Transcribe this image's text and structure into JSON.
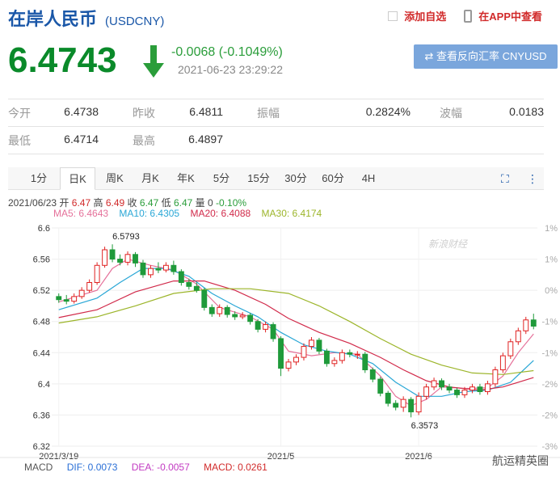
{
  "header": {
    "name": "在岸人民币",
    "code": "(USDCNY)",
    "add_watch": "添加自选",
    "app_view": "在APP中查看"
  },
  "quote": {
    "price": "6.4743",
    "change": "-0.0068 (-0.1049%)",
    "timestamp": "2021-06-23 23:29:22",
    "reverse_button": "⇄ 查看反向汇率 CNYUSD",
    "down_color": "#0a8a2a"
  },
  "stats": [
    [
      {
        "label": "今开",
        "value": "6.4738"
      },
      {
        "label": "昨收",
        "value": "6.4811"
      },
      {
        "label": "振幅",
        "value": "0.2824%"
      },
      {
        "label": "波幅",
        "value": "0.0183"
      }
    ],
    [
      {
        "label": "最低",
        "value": "6.4714"
      },
      {
        "label": "最高",
        "value": "6.4897"
      }
    ]
  ],
  "tabs": [
    "1分",
    "日K",
    "周K",
    "月K",
    "年K",
    "5分",
    "15分",
    "30分",
    "60分",
    "4H"
  ],
  "active_tab": "日K",
  "ohlc": {
    "date": "2021/06/23",
    "open_label": "开",
    "open": "6.47",
    "high_label": "高",
    "high": "6.49",
    "close_label": "收",
    "close": "6.47",
    "low_label": "低",
    "low": "6.47",
    "vol_label": "量",
    "vol": "0",
    "pct": "-0.10%"
  },
  "ma_legend": [
    {
      "text": "MA5: 6.4643",
      "color": "#e5719a"
    },
    {
      "text": "MA10: 6.4305",
      "color": "#2aa7d6"
    },
    {
      "text": "MA20: 6.4088",
      "color": "#d12a4a"
    },
    {
      "text": "MA30: 6.4174",
      "color": "#9cb52a"
    }
  ],
  "macd": {
    "label": "MACD",
    "dif": "DIF: 0.0073",
    "dea": "DEA: -0.0057",
    "macd": "MACD: 0.0261",
    "axis_value": "1"
  },
  "watermark": "新浪财经",
  "wechat_caption": "航运精英圈",
  "chart_data": {
    "type": "candlestick",
    "y_ticks": [
      "6.6",
      "6.56",
      "6.52",
      "6.48",
      "6.44",
      "6.4",
      "6.36",
      "6.32"
    ],
    "ylim": [
      6.32,
      6.6
    ],
    "pct_ticks": [
      "1%",
      "1%",
      "0%",
      "-1%",
      "-1%",
      "-2%",
      "-2%",
      "-3%"
    ],
    "x_labels": [
      {
        "label": "2021/3/19",
        "index": 0
      },
      {
        "label": "2021/5",
        "index": 29
      },
      {
        "label": "2021/6",
        "index": 47
      }
    ],
    "annotations": [
      {
        "text": "6.5793",
        "index": 7,
        "value": 6.5793
      },
      {
        "text": "6.3573",
        "index": 46,
        "value": 6.3573
      }
    ],
    "candles": [
      [
        6.512,
        6.508,
        6.516,
        6.504
      ],
      [
        6.508,
        6.506,
        6.514,
        6.502
      ],
      [
        6.506,
        6.512,
        6.516,
        6.503
      ],
      [
        6.512,
        6.52,
        6.524,
        6.509
      ],
      [
        6.52,
        6.53,
        6.534,
        6.517
      ],
      [
        6.53,
        6.552,
        6.556,
        6.527
      ],
      [
        6.552,
        6.572,
        6.576,
        6.549
      ],
      [
        6.572,
        6.56,
        6.579,
        6.556
      ],
      [
        6.56,
        6.556,
        6.566,
        6.552
      ],
      [
        6.556,
        6.566,
        6.57,
        6.552
      ],
      [
        6.566,
        6.555,
        6.569,
        6.55
      ],
      [
        6.555,
        6.54,
        6.559,
        6.536
      ],
      [
        6.54,
        6.548,
        6.552,
        6.536
      ],
      [
        6.548,
        6.546,
        6.556,
        6.542
      ],
      [
        6.546,
        6.552,
        6.556,
        6.543
      ],
      [
        6.552,
        6.544,
        6.558,
        6.54
      ],
      [
        6.544,
        6.53,
        6.547,
        6.526
      ],
      [
        6.53,
        6.525,
        6.535,
        6.521
      ],
      [
        6.525,
        6.52,
        6.53,
        6.517
      ],
      [
        6.52,
        6.498,
        6.523,
        6.494
      ],
      [
        6.498,
        6.49,
        6.502,
        6.486
      ],
      [
        6.49,
        6.498,
        6.502,
        6.486
      ],
      [
        6.498,
        6.489,
        6.501,
        6.485
      ],
      [
        6.489,
        6.486,
        6.493,
        6.482
      ],
      [
        6.486,
        6.488,
        6.492,
        6.483
      ],
      [
        6.488,
        6.48,
        6.491,
        6.476
      ],
      [
        6.48,
        6.47,
        6.483,
        6.466
      ],
      [
        6.47,
        6.476,
        6.48,
        6.466
      ],
      [
        6.476,
        6.458,
        6.479,
        6.454
      ],
      [
        6.458,
        6.42,
        6.461,
        6.41
      ],
      [
        6.42,
        6.428,
        6.432,
        6.416
      ],
      [
        6.428,
        6.434,
        6.438,
        6.424
      ],
      [
        6.434,
        6.448,
        6.452,
        6.43
      ],
      [
        6.448,
        6.456,
        6.46,
        6.444
      ],
      [
        6.456,
        6.442,
        6.459,
        6.438
      ],
      [
        6.442,
        6.426,
        6.445,
        6.422
      ],
      [
        6.426,
        6.43,
        6.434,
        6.422
      ],
      [
        6.43,
        6.44,
        6.444,
        6.426
      ],
      [
        6.44,
        6.438,
        6.444,
        6.434
      ],
      [
        6.438,
        6.438,
        6.442,
        6.432
      ],
      [
        6.438,
        6.418,
        6.441,
        6.414
      ],
      [
        6.418,
        6.406,
        6.421,
        6.402
      ],
      [
        6.406,
        6.388,
        6.409,
        6.384
      ],
      [
        6.388,
        6.375,
        6.391,
        6.371
      ],
      [
        6.375,
        6.37,
        6.379,
        6.366
      ],
      [
        6.37,
        6.38,
        6.384,
        6.364
      ],
      [
        6.38,
        6.364,
        6.383,
        6.357
      ],
      [
        6.364,
        6.384,
        6.389,
        6.36
      ],
      [
        6.384,
        6.396,
        6.4,
        6.38
      ],
      [
        6.396,
        6.404,
        6.408,
        6.392
      ],
      [
        6.404,
        6.396,
        6.407,
        6.392
      ],
      [
        6.396,
        6.392,
        6.4,
        6.388
      ],
      [
        6.392,
        6.386,
        6.395,
        6.382
      ],
      [
        6.386,
        6.392,
        6.396,
        6.382
      ],
      [
        6.392,
        6.396,
        6.4,
        6.388
      ],
      [
        6.396,
        6.39,
        6.4,
        6.386
      ],
      [
        6.39,
        6.4,
        6.404,
        6.386
      ],
      [
        6.4,
        6.418,
        6.422,
        6.396
      ],
      [
        6.418,
        6.436,
        6.44,
        6.414
      ],
      [
        6.436,
        6.454,
        6.458,
        6.432
      ],
      [
        6.454,
        6.468,
        6.472,
        6.45
      ],
      [
        6.468,
        6.482,
        6.486,
        6.464
      ],
      [
        6.482,
        6.474,
        6.49,
        6.47
      ]
    ],
    "ma_lines": {
      "MA5": [
        [
          0,
          6.505
        ],
        [
          5,
          6.52
        ],
        [
          7,
          6.548
        ],
        [
          9,
          6.56
        ],
        [
          12,
          6.552
        ],
        [
          15,
          6.546
        ],
        [
          18,
          6.528
        ],
        [
          21,
          6.498
        ],
        [
          25,
          6.486
        ],
        [
          28,
          6.47
        ],
        [
          30,
          6.442
        ],
        [
          33,
          6.436
        ],
        [
          36,
          6.44
        ],
        [
          39,
          6.438
        ],
        [
          42,
          6.41
        ],
        [
          44,
          6.384
        ],
        [
          46,
          6.372
        ],
        [
          48,
          6.38
        ],
        [
          50,
          6.396
        ],
        [
          53,
          6.394
        ],
        [
          56,
          6.395
        ],
        [
          58,
          6.41
        ],
        [
          60,
          6.44
        ],
        [
          62,
          6.464
        ]
      ],
      "MA10": [
        [
          0,
          6.495
        ],
        [
          5,
          6.51
        ],
        [
          8,
          6.53
        ],
        [
          11,
          6.548
        ],
        [
          14,
          6.548
        ],
        [
          17,
          6.538
        ],
        [
          20,
          6.516
        ],
        [
          23,
          6.5
        ],
        [
          26,
          6.486
        ],
        [
          29,
          6.466
        ],
        [
          32,
          6.45
        ],
        [
          35,
          6.442
        ],
        [
          38,
          6.438
        ],
        [
          41,
          6.426
        ],
        [
          44,
          6.402
        ],
        [
          47,
          6.384
        ],
        [
          50,
          6.384
        ],
        [
          53,
          6.39
        ],
        [
          56,
          6.392
        ],
        [
          59,
          6.402
        ],
        [
          62,
          6.43
        ]
      ],
      "MA20": [
        [
          0,
          6.485
        ],
        [
          5,
          6.495
        ],
        [
          10,
          6.518
        ],
        [
          15,
          6.532
        ],
        [
          19,
          6.532
        ],
        [
          23,
          6.52
        ],
        [
          27,
          6.502
        ],
        [
          30,
          6.484
        ],
        [
          34,
          6.466
        ],
        [
          38,
          6.452
        ],
        [
          42,
          6.434
        ],
        [
          45,
          6.418
        ],
        [
          48,
          6.404
        ],
        [
          51,
          6.396
        ],
        [
          55,
          6.392
        ],
        [
          58,
          6.396
        ],
        [
          62,
          6.408
        ]
      ],
      "MA30": [
        [
          0,
          6.478
        ],
        [
          5,
          6.486
        ],
        [
          10,
          6.5
        ],
        [
          15,
          6.516
        ],
        [
          20,
          6.522
        ],
        [
          25,
          6.522
        ],
        [
          30,
          6.516
        ],
        [
          34,
          6.5
        ],
        [
          38,
          6.48
        ],
        [
          42,
          6.458
        ],
        [
          46,
          6.438
        ],
        [
          50,
          6.424
        ],
        [
          54,
          6.414
        ],
        [
          58,
          6.412
        ],
        [
          62,
          6.417
        ]
      ]
    }
  }
}
